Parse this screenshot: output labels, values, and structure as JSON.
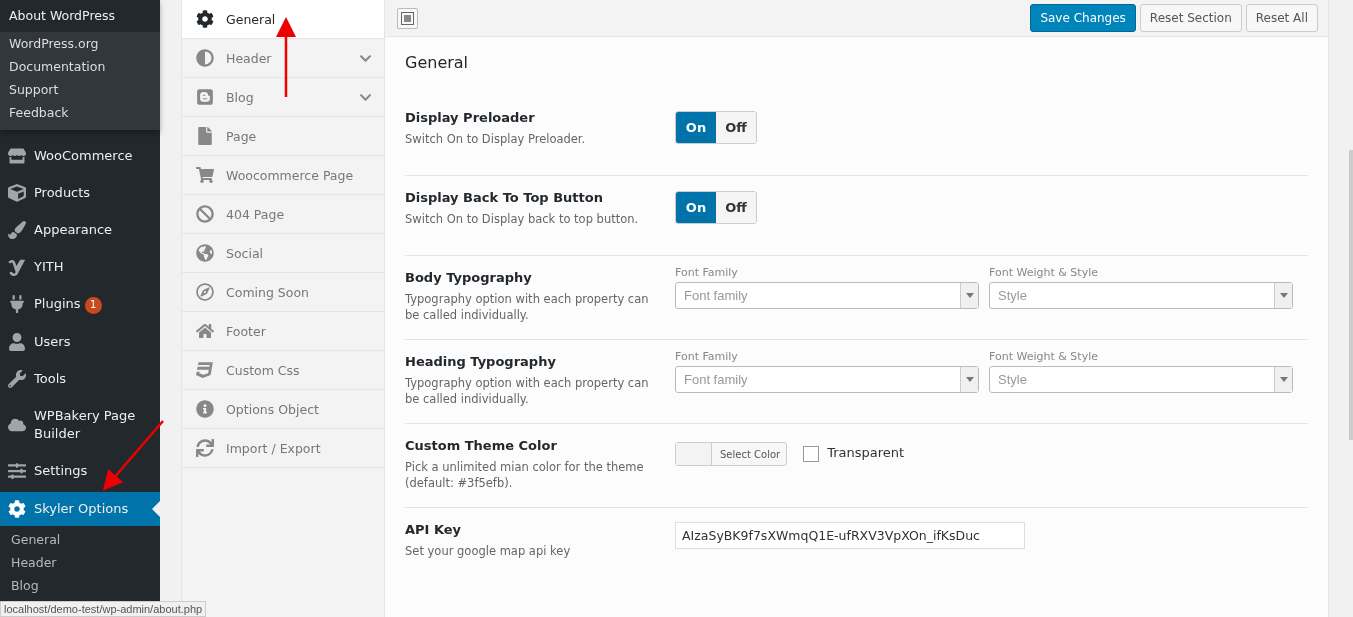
{
  "admin_menu": {
    "flyout": {
      "title": "About WordPress",
      "items": [
        "WordPress.org",
        "Documentation",
        "Support",
        "Feedback"
      ]
    },
    "items": [
      {
        "label": "WooCommerce",
        "selected": false
      },
      {
        "label": "Products",
        "selected": false
      },
      {
        "label": "Appearance",
        "selected": false
      },
      {
        "label": "YITH",
        "selected": false
      },
      {
        "label": "Plugins",
        "selected": false,
        "badge": "1"
      },
      {
        "label": "Users",
        "selected": false
      },
      {
        "label": "Tools",
        "selected": false
      },
      {
        "label": "WPBakery Page Builder",
        "selected": false
      },
      {
        "label": "Settings",
        "selected": false
      },
      {
        "label": "Skyler Options",
        "selected": true
      }
    ],
    "submenu": [
      "General",
      "Header",
      "Blog"
    ]
  },
  "options_nav": [
    {
      "label": "General",
      "selected": true,
      "expandable": false
    },
    {
      "label": "Header",
      "selected": false,
      "expandable": true
    },
    {
      "label": "Blog",
      "selected": false,
      "expandable": true
    },
    {
      "label": "Page",
      "selected": false,
      "expandable": false
    },
    {
      "label": "Woocommerce Page",
      "selected": false,
      "expandable": false
    },
    {
      "label": "404 Page",
      "selected": false,
      "expandable": false
    },
    {
      "label": "Social",
      "selected": false,
      "expandable": false
    },
    {
      "label": "Coming Soon",
      "selected": false,
      "expandable": false
    },
    {
      "label": "Footer",
      "selected": false,
      "expandable": false
    },
    {
      "label": "Custom Css",
      "selected": false,
      "expandable": false
    },
    {
      "label": "Options Object",
      "selected": false,
      "expandable": false
    },
    {
      "label": "Import / Export",
      "selected": false,
      "expandable": false
    }
  ],
  "toolbar": {
    "buttons": [
      {
        "label": "Save Changes",
        "kind": "primary"
      },
      {
        "label": "Reset Section",
        "kind": "secondary"
      },
      {
        "label": "Reset All",
        "kind": "secondary"
      }
    ]
  },
  "section_title": "General",
  "fields": [
    {
      "kind": "switch",
      "title": "Display Preloader",
      "description": "Switch On to Display Preloader.",
      "options": [
        {
          "label": "On",
          "selected": true
        },
        {
          "label": "Off",
          "selected": false
        }
      ]
    },
    {
      "kind": "switch",
      "title": "Display Back To Top Button",
      "description": "Switch On to Display back to top button.",
      "options": [
        {
          "label": "On",
          "selected": true
        },
        {
          "label": "Off",
          "selected": false
        }
      ]
    },
    {
      "kind": "typography",
      "title": "Body Typography",
      "description": "Typography option with each property can be called individually.",
      "family_label": "Font Family",
      "family_placeholder": "Font family",
      "style_label": "Font Weight & Style",
      "style_placeholder": "Style"
    },
    {
      "kind": "typography",
      "title": "Heading Typography",
      "description": "Typography option with each property can be called individually.",
      "family_label": "Font Family",
      "family_placeholder": "Font family",
      "style_label": "Font Weight & Style",
      "style_placeholder": "Style"
    },
    {
      "kind": "color",
      "title": "Custom Theme Color",
      "description": "Pick a unlimited mian color for the theme (default: #3f5efb).",
      "button": "Select Color",
      "transparent_label": "Transparent",
      "transparent_checked": false
    },
    {
      "kind": "text",
      "title": "API Key",
      "description": "Set your google map api key",
      "value": "AIzaSyBK9f7sXWmqQ1E-ufRXV3VpXOn_ifKsDuc"
    }
  ],
  "status_url": "localhost/demo-test/wp-admin/about.php"
}
